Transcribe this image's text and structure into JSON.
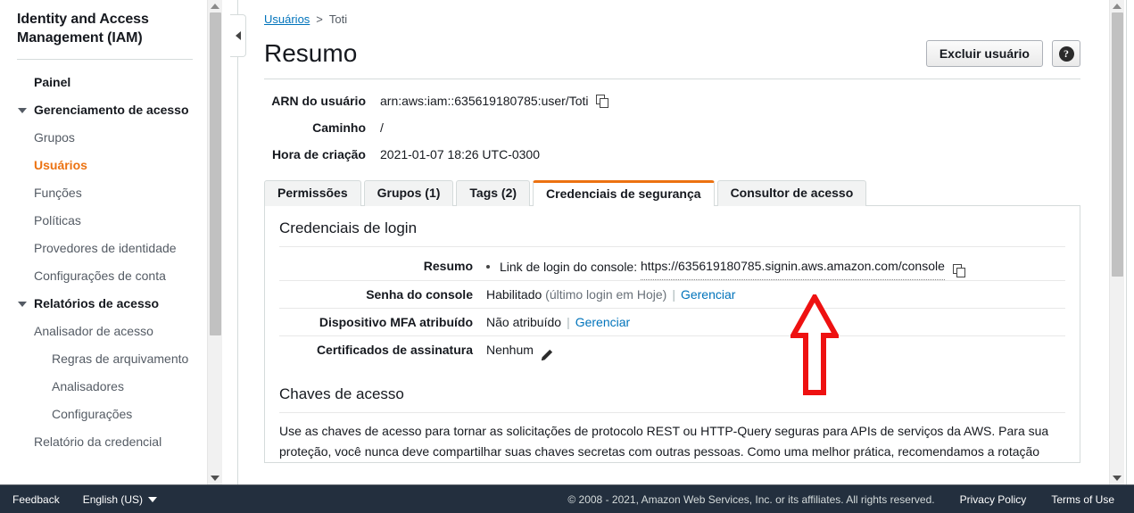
{
  "sidebar": {
    "title": "Identity and Access Management (IAM)",
    "items": [
      {
        "label": "Painel",
        "style": "bold"
      },
      {
        "label": "Gerenciamento de acesso",
        "style": "group"
      },
      {
        "label": "Grupos",
        "style": "normal"
      },
      {
        "label": "Usuários",
        "style": "active"
      },
      {
        "label": "Funções",
        "style": "normal"
      },
      {
        "label": "Políticas",
        "style": "normal"
      },
      {
        "label": "Provedores de identidade",
        "style": "normal"
      },
      {
        "label": "Configurações de conta",
        "style": "normal"
      },
      {
        "label": "Relatórios de acesso",
        "style": "group"
      },
      {
        "label": "Analisador de acesso",
        "style": "normal"
      },
      {
        "label": "Regras de arquivamento",
        "style": "sub"
      },
      {
        "label": "Analisadores",
        "style": "sub"
      },
      {
        "label": "Configurações",
        "style": "sub"
      },
      {
        "label": "Relatório da credencial",
        "style": "normal"
      }
    ]
  },
  "breadcrumb": {
    "root": "Usuários",
    "separator": ">",
    "current": "Toti"
  },
  "header": {
    "title": "Resumo",
    "delete_button": "Excluir usuário",
    "help_icon": "?"
  },
  "summary": {
    "rows": [
      {
        "label": "ARN do usuário",
        "value": "arn:aws:iam::635619180785:user/Toti",
        "copy": true
      },
      {
        "label": "Caminho",
        "value": "/",
        "copy": false
      },
      {
        "label": "Hora de criação",
        "value": "2021-01-07 18:26 UTC-0300",
        "copy": false
      }
    ]
  },
  "tabs": [
    {
      "label": "Permissões",
      "active": false
    },
    {
      "label": "Grupos (1)",
      "active": false
    },
    {
      "label": "Tags (2)",
      "active": false
    },
    {
      "label": "Credenciais de segurança",
      "active": true
    },
    {
      "label": "Consultor de acesso",
      "active": false
    }
  ],
  "login_credentials": {
    "section_title": "Credenciais de login",
    "summary_label": "Resumo",
    "console_link_prefix": "Link de login do console:",
    "console_link_url": "https://635619180785.signin.aws.amazon.com/console",
    "password_label": "Senha do console",
    "password_value": "Habilitado",
    "password_note": "(último login em Hoje)",
    "password_manage": "Gerenciar",
    "mfa_label": "Dispositivo MFA atribuído",
    "mfa_value": "Não atribuído",
    "mfa_manage": "Gerenciar",
    "cert_label": "Certificados de assinatura",
    "cert_value": "Nenhum"
  },
  "access_keys": {
    "section_title": "Chaves de acesso",
    "description": "Use as chaves de acesso para tornar as solicitações de protocolo REST ou HTTP-Query seguras para APIs de serviços da AWS. Para sua proteção, você nunca deve compartilhar suas chaves secretas com outras pessoas. Como uma melhor prática, recomendamos a rotação"
  },
  "annotation": {
    "shape": "up-arrow",
    "color": "#ee1111"
  },
  "footer": {
    "feedback": "Feedback",
    "language": "English (US)",
    "copyright": "© 2008 - 2021, Amazon Web Services, Inc. or its affiliates. All rights reserved.",
    "privacy": "Privacy Policy",
    "terms": "Terms of Use"
  },
  "colors": {
    "accent_orange": "#ec7211",
    "link_blue": "#0073bb",
    "footer_bg": "#232f3e",
    "annotation_red": "#ee1111"
  }
}
